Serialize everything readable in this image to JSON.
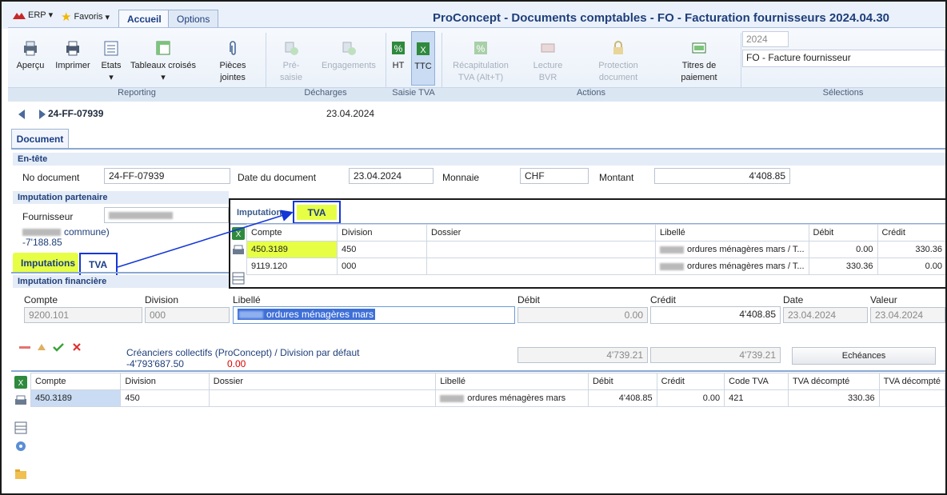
{
  "titlebar": {
    "erp_label": "ERP",
    "favoris_label": "Favoris",
    "tabs": [
      "Accueil",
      "Options"
    ],
    "window_title": "ProConcept - Documents comptables - FO - Facturation fournisseurs 2024.04.30"
  },
  "ribbon": {
    "buttons": {
      "apercu": "Aperçu",
      "imprimer": "Imprimer",
      "etats": "Etats",
      "tableaux": "Tableaux croisés",
      "pieces_1": "Pièces",
      "pieces_2": "jointes",
      "presaisie_1": "Pré-",
      "presaisie_2": "saisie",
      "engagements": "Engagements",
      "ht": "HT",
      "ttc": "TTC",
      "recap_1": "Récapitulation",
      "recap_2": "TVA (Alt+T)",
      "lecture_1": "Lecture",
      "lecture_2": "BVR",
      "protection_1": "Protection",
      "protection_2": "document",
      "titres_1": "Titres de",
      "titres_2": "paiement"
    },
    "groups": {
      "reporting": "Reporting",
      "decharges": "Décharges",
      "saisie_tva": "Saisie TVA",
      "actions": "Actions",
      "selections": "Sélections"
    },
    "selection_year": "2024",
    "selection_doc_type": "FO - Facture fournisseur"
  },
  "doc": {
    "number": "24-FF-07939",
    "date": "23.04.2024",
    "tab": "Document"
  },
  "entete": {
    "title": "En-tête",
    "no_document_label": "No document",
    "no_document": "24-FF-07939",
    "date_label": "Date du document",
    "date": "23.04.2024",
    "monnaie_label": "Monnaie",
    "monnaie": "CHF",
    "montant_label": "Montant",
    "montant": "4'408.85"
  },
  "partenaire": {
    "title": "Imputation partenaire",
    "fournisseur_label": "Fournisseur",
    "commune_suffix": "commune)",
    "balance": "-7'188.85"
  },
  "subtabs": {
    "imputations": "Imputations",
    "tva": "TVA"
  },
  "financiere": {
    "title": "Imputation financière",
    "headers": [
      "Compte",
      "Division",
      "Libellé",
      "Débit",
      "Crédit",
      "Date",
      "Valeur"
    ],
    "compte": "9200.101",
    "division": "000",
    "libelle": "ordures ménagères mars",
    "debit": "0.00",
    "credit": "4'408.85",
    "date": "23.04.2024",
    "valeur": "23.04.2024",
    "creanciers": "Créanciers collectifs (ProConcept) / Division par défaut",
    "creanciers_balance": "-4'793'687.50",
    "creanciers_diff": "0.00",
    "total_debit": "4'739.21",
    "total_credit": "4'739.21",
    "echeances": "Echéances"
  },
  "bottom_grid": {
    "headers": [
      "Compte",
      "Division",
      "Dossier",
      "Libellé",
      "Débit",
      "Crédit",
      "Code TVA",
      "TVA décompté",
      "TVA décompté"
    ],
    "rows": [
      [
        "450.3189",
        "450",
        "",
        "ordures ménagères mars",
        "4'408.85",
        "0.00",
        "421",
        "330.36",
        ""
      ]
    ]
  },
  "overlay": {
    "tab_imputation": "Imputation",
    "tab_tva": "TVA",
    "headers": [
      "Compte",
      "Division",
      "Dossier",
      "Libellé",
      "Débit",
      "Crédit"
    ],
    "rows": [
      [
        "450.3189",
        "450",
        "",
        "ordures ménagères mars / T...",
        "0.00",
        "330.36"
      ],
      [
        "9119.120",
        "000",
        "",
        "ordures ménagères mars / T...",
        "330.36",
        "0.00"
      ]
    ]
  },
  "colors": {
    "highlight": "#e6ff45",
    "callout_border": "#1437d6",
    "title": "#1f3f7a"
  }
}
